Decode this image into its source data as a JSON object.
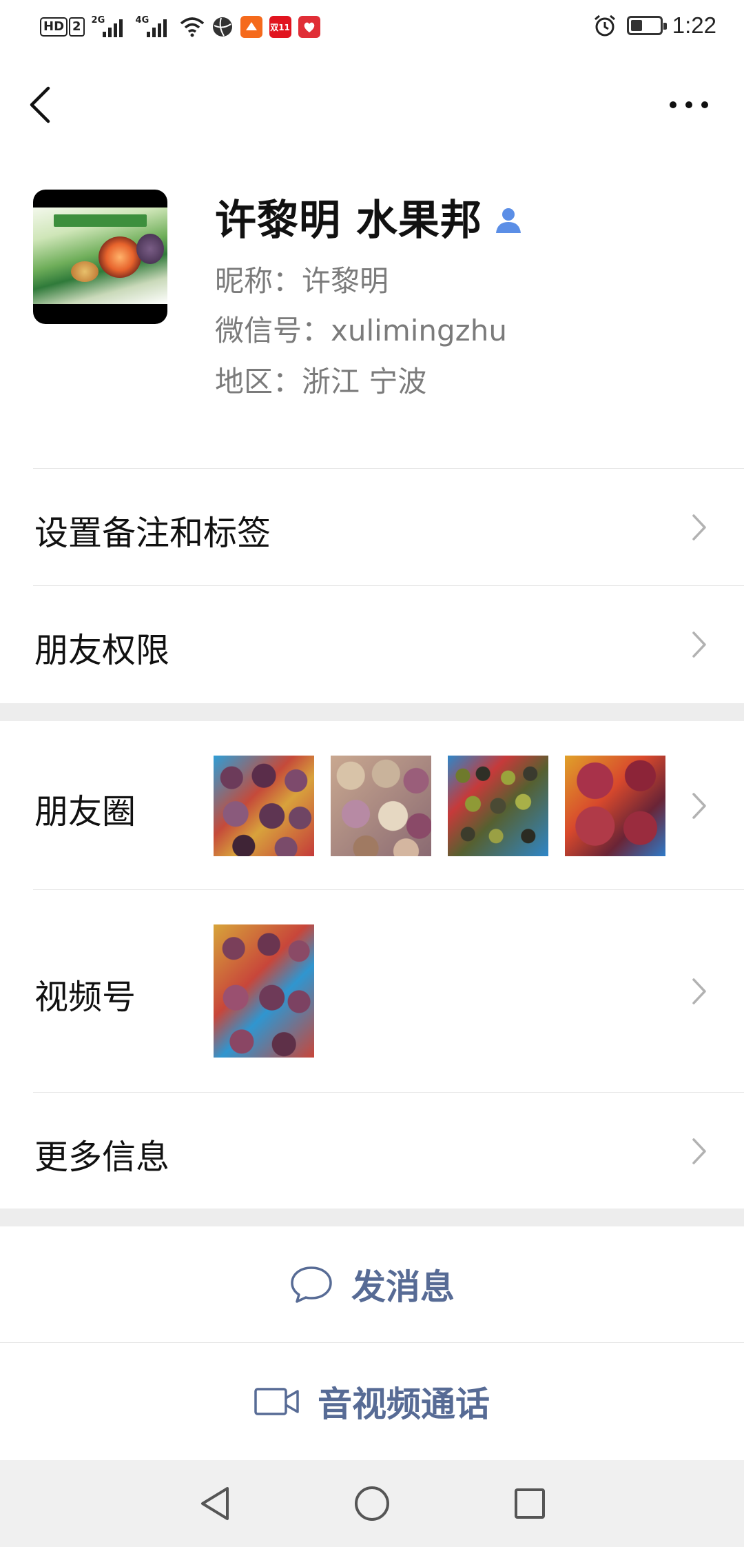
{
  "status_bar": {
    "hd_label": "HD",
    "sim_label": "2",
    "signal1_net": "2G",
    "signal2_net": "4G",
    "badge_double11": "双11",
    "battery_level_percent": 40,
    "time": "1:22"
  },
  "profile": {
    "name": "许黎明 水果邦",
    "nickname_line": "昵称：许黎明",
    "wechat_id_line": "微信号：xulimingzhu",
    "region_line": "地区：浙江  宁波"
  },
  "menu": {
    "remark_tags_label": "设置备注和标签",
    "friend_permissions_label": "朋友权限",
    "moments_label": "朋友圈",
    "channels_label": "视频号",
    "more_info_label": "更多信息"
  },
  "actions": {
    "send_message_label": "发消息",
    "video_call_label": "音视频通话"
  },
  "colors": {
    "link_blue": "#576b95",
    "separator_gray": "#ededed",
    "verified_icon_blue": "#5b8ee6"
  }
}
